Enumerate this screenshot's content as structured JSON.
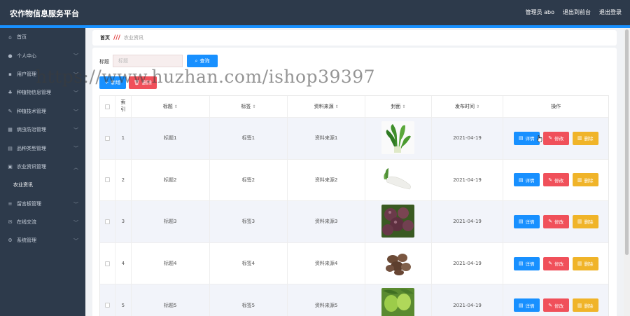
{
  "app": {
    "title": "农作物信息服务平台"
  },
  "header": {
    "admin": "管理员 abo",
    "back_home": "退出到前台",
    "logout": "退出登录"
  },
  "sidebar": {
    "items": [
      {
        "label": "首页",
        "icon": "home-icon",
        "glyph": "⌂",
        "chevron": false
      },
      {
        "label": "个人中心",
        "icon": "user-icon",
        "glyph": "●",
        "chevron": true
      },
      {
        "label": "用户管理",
        "icon": "users-icon",
        "glyph": "▪",
        "chevron": true
      },
      {
        "label": "种植物信息管理",
        "icon": "plant-icon",
        "glyph": "♣",
        "chevron": true
      },
      {
        "label": "种植技术管理",
        "icon": "tool-icon",
        "glyph": "✎",
        "chevron": true
      },
      {
        "label": "病虫防治管理",
        "icon": "grid-icon",
        "glyph": "▦",
        "chevron": true
      },
      {
        "label": "品种类型管理",
        "icon": "box-icon",
        "glyph": "▤",
        "chevron": true
      },
      {
        "label": "农业资讯管理",
        "icon": "news-icon",
        "glyph": "▣",
        "chevron": "up"
      },
      {
        "label": "农业资讯",
        "icon": "",
        "glyph": "",
        "chevron": false,
        "sub": true
      },
      {
        "label": "留言板管理",
        "icon": "list-icon",
        "glyph": "≡",
        "chevron": true
      },
      {
        "label": "在线交流",
        "icon": "chat-icon",
        "glyph": "✉",
        "chevron": true
      },
      {
        "label": "系统管理",
        "icon": "settings-icon",
        "glyph": "⚙",
        "chevron": true
      }
    ]
  },
  "breadcrumb": {
    "home": "首页",
    "current": "农业资讯"
  },
  "search": {
    "label": "标题",
    "placeholder": "标题",
    "button": "查询"
  },
  "actions": {
    "add": "新增",
    "delete": "删除"
  },
  "table": {
    "headers": {
      "index": "索引",
      "title": "标题",
      "tag": "标签",
      "source": "资料来源",
      "cover": "封面",
      "date": "发布时间",
      "ops": "操作"
    },
    "ops": {
      "detail": "详情",
      "edit": "修改",
      "remove": "删除"
    },
    "rows": [
      {
        "index": "1",
        "title": "标题1",
        "tag": "标签1",
        "source": "资料来源1",
        "date": "2021-04-19",
        "cover": "leafy-greens"
      },
      {
        "index": "2",
        "title": "标题2",
        "tag": "标签2",
        "source": "资料来源2",
        "date": "2021-04-19",
        "cover": "white-radish"
      },
      {
        "index": "3",
        "title": "标题3",
        "tag": "标签3",
        "source": "资料来源3",
        "date": "2021-04-19",
        "cover": "purple-fruit"
      },
      {
        "index": "4",
        "title": "标题4",
        "tag": "标签4",
        "source": "资料来源4",
        "date": "2021-04-19",
        "cover": "dried-nuts"
      },
      {
        "index": "5",
        "title": "标题5",
        "tag": "标签5",
        "source": "资料来源5",
        "date": "2021-04-19",
        "cover": "green-fruit"
      }
    ]
  },
  "watermark": "https://www.huzhan.com/ishop39397",
  "colors": {
    "header_bg": "#2d3a4b",
    "accent": "#1890ff",
    "danger": "#f0505a",
    "warning": "#f0b429"
  }
}
